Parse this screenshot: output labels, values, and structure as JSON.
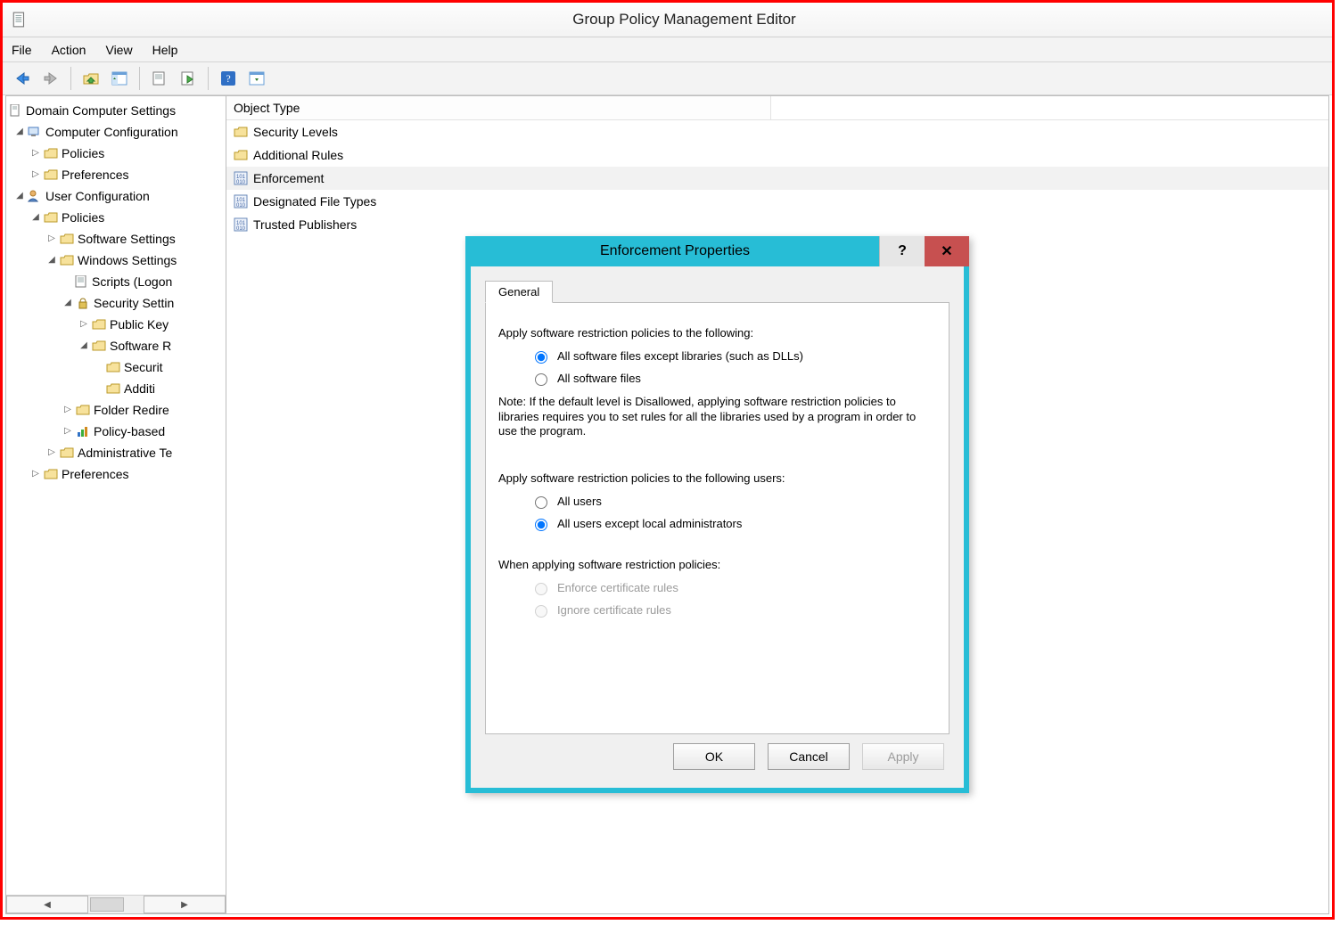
{
  "window": {
    "title": "Group Policy Management Editor"
  },
  "menu": {
    "file": "File",
    "action": "Action",
    "view": "View",
    "help": "Help"
  },
  "tree": {
    "root": "Domain Computer Settings",
    "computer_conf": "Computer Configuration",
    "cc_policies": "Policies",
    "cc_prefs": "Preferences",
    "user_conf": "User Configuration",
    "uc_policies": "Policies",
    "software_settings": "Software Settings",
    "windows_settings": "Windows Settings",
    "scripts": "Scripts (Logon",
    "security_settings": "Security Settin",
    "public_key": "Public Key",
    "software_restriction": "Software R",
    "sr_security": "Securit",
    "sr_additional": "Additi",
    "folder_redir": "Folder Redire",
    "policy_based": "Policy-based",
    "admin_templates": "Administrative Te",
    "uc_prefs": "Preferences"
  },
  "list": {
    "header": "Object Type",
    "rows": [
      "Security Levels",
      "Additional Rules",
      "Enforcement",
      "Designated File Types",
      "Trusted Publishers"
    ],
    "selected_index": 2
  },
  "dialog": {
    "title": "Enforcement Properties",
    "tab": "General",
    "section1_label": "Apply software restriction policies to the following:",
    "opt1a": "All software files except libraries (such as DLLs)",
    "opt1b": "All software files",
    "section1_selected": "a",
    "note": "Note:  If the default level is Disallowed, applying software restriction policies to libraries requires you to set rules for all the libraries used by a program in order to use the program.",
    "section2_label": "Apply software restriction policies to the following users:",
    "opt2a": "All users",
    "opt2b": "All users except local administrators",
    "section2_selected": "b",
    "section3_label": "When applying software restriction policies:",
    "opt3a": "Enforce certificate rules",
    "opt3b": "Ignore certificate rules",
    "buttons": {
      "ok": "OK",
      "cancel": "Cancel",
      "apply": "Apply"
    },
    "help_symbol": "?",
    "close_symbol": "✕"
  }
}
